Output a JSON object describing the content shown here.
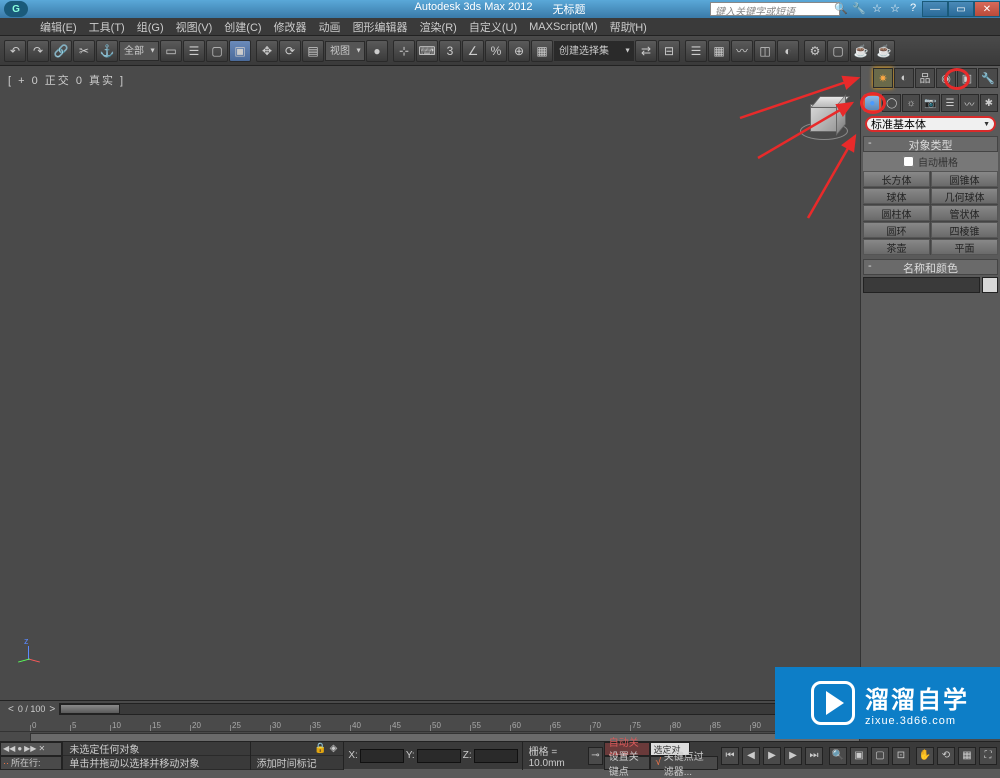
{
  "title": {
    "app": "Autodesk 3ds Max  2012",
    "doc": "无标题"
  },
  "search_placeholder": "键入关键字或短语",
  "menus": [
    "编辑(E)",
    "工具(T)",
    "组(G)",
    "视图(V)",
    "创建(C)",
    "修改器",
    "动画",
    "图形编辑器",
    "渲染(R)",
    "自定义(U)",
    "MAXScript(M)",
    "帮助(H)"
  ],
  "toolbar": {
    "select_filter": "全部",
    "view_label": "视图",
    "selection_set": "创建选择集"
  },
  "viewport_label": "[ + 0 正交 0 真实 ]",
  "timeline": {
    "position": "0 / 100",
    "ruler": [
      "0",
      "5",
      "10",
      "15",
      "20",
      "25",
      "30",
      "35",
      "40",
      "45",
      "50",
      "55",
      "60",
      "65",
      "70",
      "75",
      "80",
      "85",
      "90"
    ]
  },
  "command_panel": {
    "dropdown": "标准基本体",
    "rollout_obj": "对象类型",
    "auto_grid": "自动栅格",
    "buttons": [
      "长方体",
      "圆锥体",
      "球体",
      "几何球体",
      "圆柱体",
      "管状体",
      "圆环",
      "四棱锥",
      "茶壶",
      "平面"
    ],
    "rollout_name": "名称和颜色"
  },
  "status": {
    "row_label": "所在行:",
    "msg1": "未选定任何对象",
    "msg2": "单击并拖动以选择并移动对象",
    "add_time_tag": "添加时间标记",
    "grid": "栅格 = 10.0mm",
    "auto_key": "自动关键点",
    "set_key": "设置关键点",
    "sel_obj": "选定对象",
    "key_filter": "关键点过滤器..."
  },
  "watermark": {
    "big": "溜溜自学",
    "small": "zixue.3d66.com"
  }
}
